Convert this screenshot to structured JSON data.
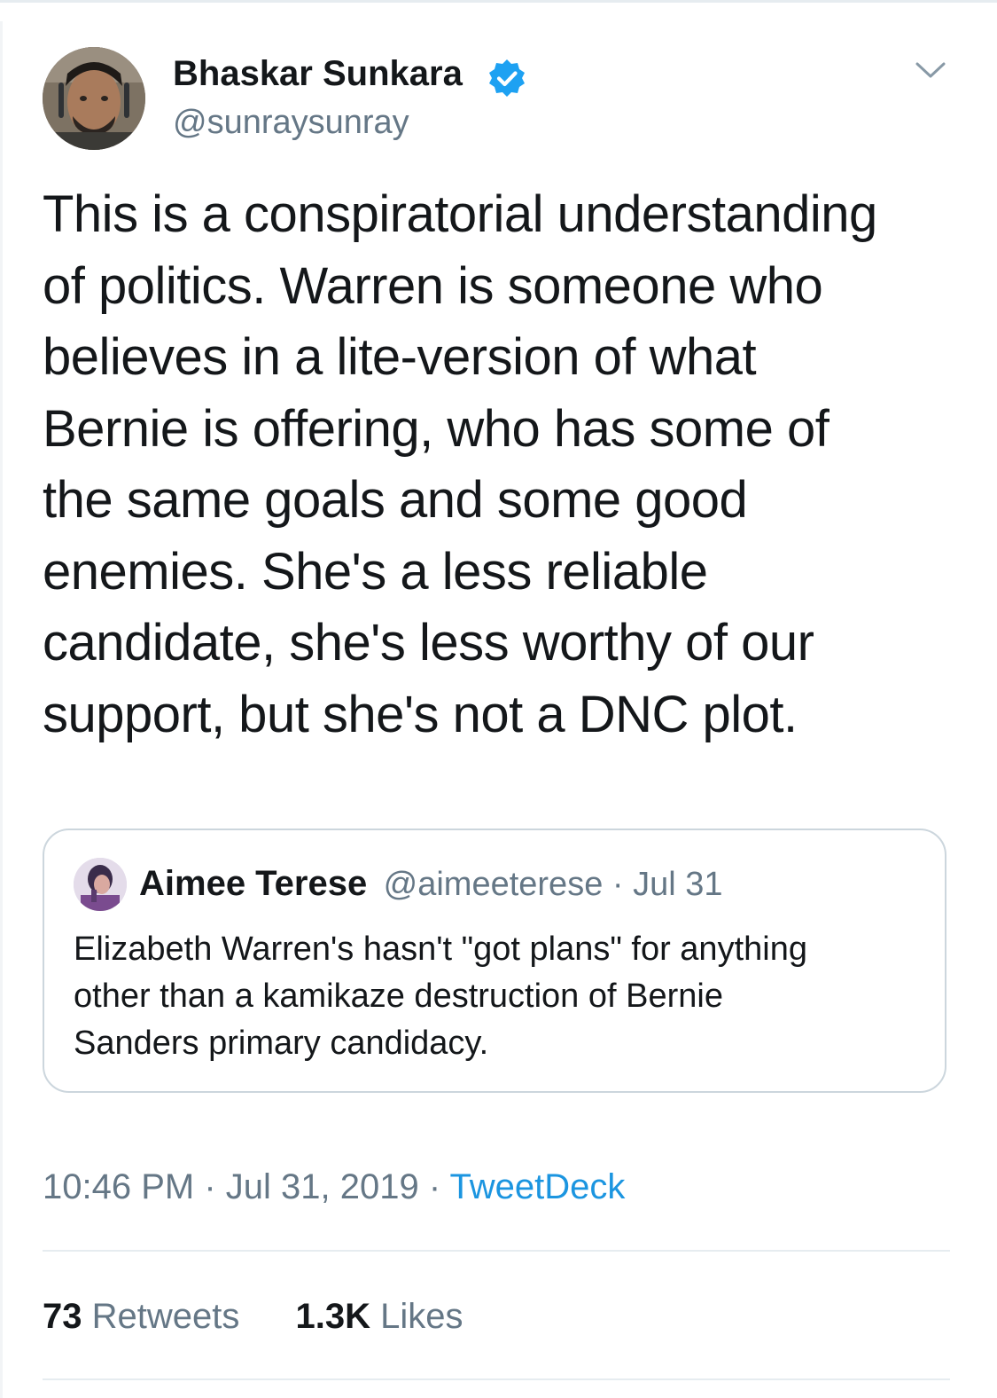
{
  "tweet": {
    "author": {
      "name": "Bhaskar Sunkara",
      "handle": "@sunraysunray",
      "verified": true
    },
    "text": "This is a conspiratorial understanding\nof politics. Warren is someone who\nbelieves in a lite-version of what\nBernie is offering, who has some of\nthe same goals and some good\nenemies. She's a less reliable\ncandidate, she's less worthy of our\nsupport, but she's not a DNC plot.",
    "quoted": {
      "name": "Aimee Terese",
      "handle": "@aimeeterese",
      "separator": " · ",
      "date": "Jul 31",
      "text": "Elizabeth Warren's hasn't \"got plans\" for anything\nother than a kamikaze destruction of Bernie\nSanders primary candidacy."
    },
    "time": "10:46 PM",
    "date": "Jul 31, 2019",
    "separator": " · ",
    "source": "TweetDeck",
    "stats": {
      "retweets_count": "73",
      "retweets_label": "Retweets",
      "likes_count": "1.3K",
      "likes_label": "Likes"
    }
  },
  "icons": {
    "verified": "verified-badge-icon",
    "menu": "chevron-down-icon"
  },
  "colors": {
    "text_primary": "#14171a",
    "text_secondary": "#657786",
    "link": "#1b95e0",
    "verified": "#1da1f2",
    "border": "#ccd6dd",
    "divider": "#e6ecf0"
  }
}
